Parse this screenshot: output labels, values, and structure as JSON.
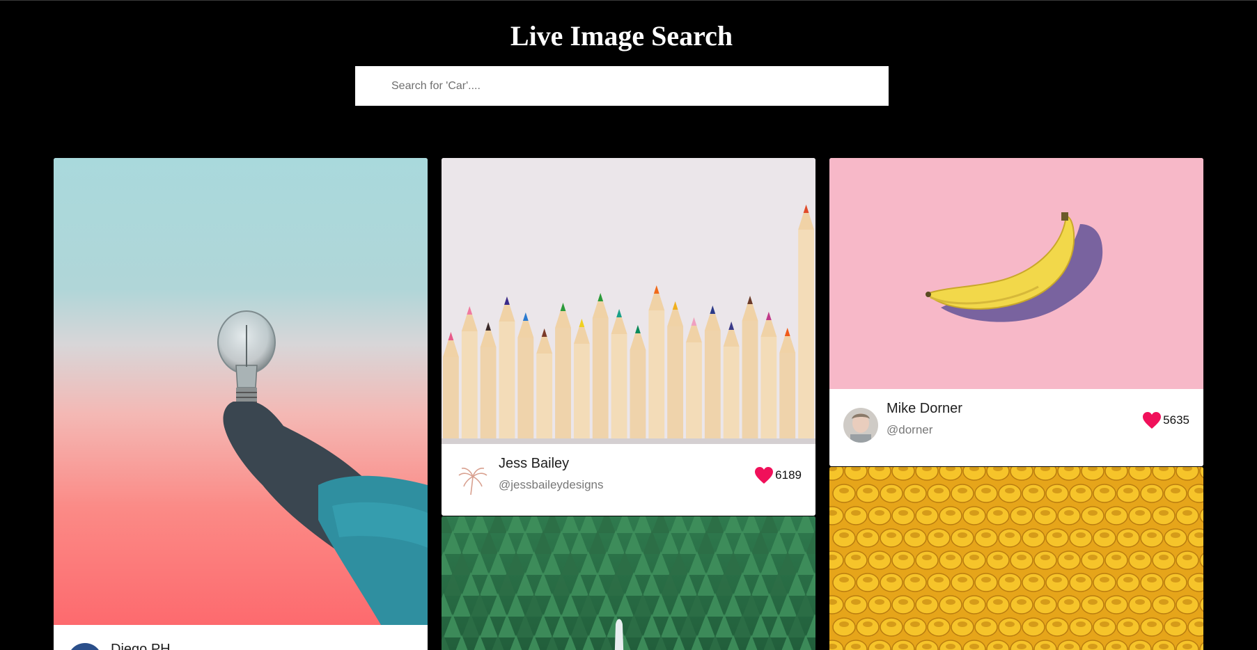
{
  "header": {
    "title": "Live Image Search"
  },
  "search": {
    "placeholder": "Search for 'Car'...."
  },
  "colors": {
    "background": "#000000",
    "heart": "#f0105a"
  },
  "cards": [
    {
      "photo": "lightbulb-in-hand",
      "name": "Diego PH",
      "handle": "",
      "likes": ""
    },
    {
      "photo": "colored-pencils",
      "name": "Jess Bailey",
      "handle": "@jessbaileydesigns",
      "likes": "6189"
    },
    {
      "photo": "pine-forest",
      "name": "",
      "handle": "",
      "likes": ""
    },
    {
      "photo": "banana-on-pink",
      "name": "Mike Dorner",
      "handle": "@dorner",
      "likes": "5635"
    },
    {
      "photo": "yellow-toy-heads",
      "name": "",
      "handle": "",
      "likes": ""
    }
  ]
}
